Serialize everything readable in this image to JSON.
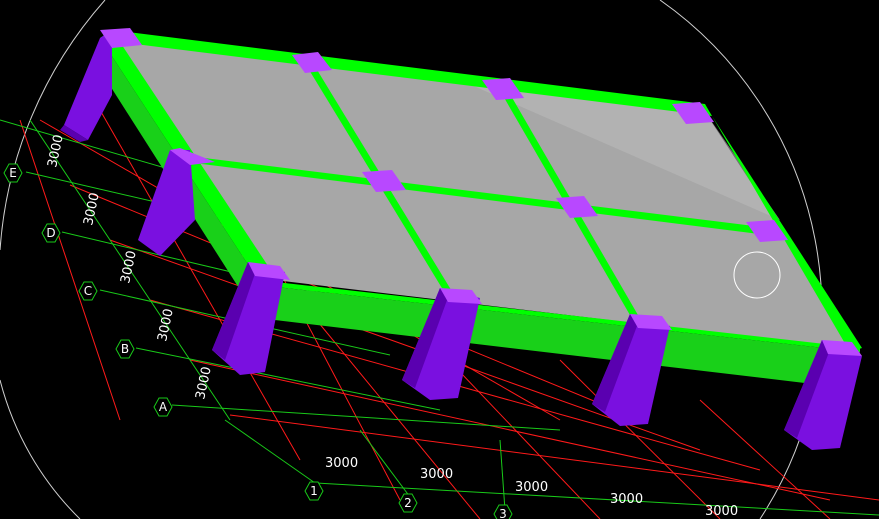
{
  "viewport": {
    "background": "#000000"
  },
  "colors": {
    "grid_red": "#ff1a1a",
    "grid_green": "#19c919",
    "beam_top": "#00ff00",
    "beam_side": "#19d019",
    "slab": "#a7a7a7",
    "column_front": "#7a10e0",
    "column_side": "#5a00b0",
    "column_top": "#b848ff"
  },
  "axes": {
    "letters": [
      "A",
      "B",
      "C",
      "D",
      "E"
    ],
    "numbers": [
      "1",
      "2",
      "3"
    ]
  },
  "dimensions": {
    "bay_spacing": "3000",
    "left_labels": [
      "3000",
      "3000",
      "3000",
      "3000",
      "3000"
    ],
    "bottom_labels": [
      "3000",
      "3000",
      "3000",
      "3000",
      "3000"
    ]
  },
  "icons": {
    "cursor": "target-circle-icon"
  }
}
